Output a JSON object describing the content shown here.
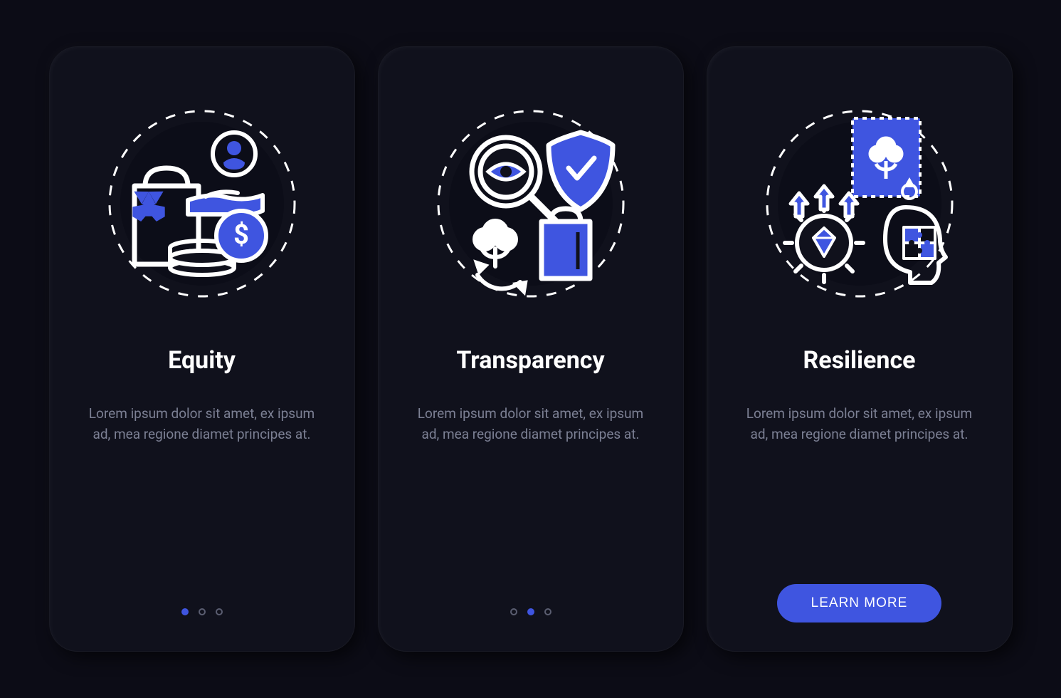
{
  "colors": {
    "accent": "#3f55e0",
    "stroke": "#ffffff",
    "bg": "#10111c",
    "text_muted": "#7c8094"
  },
  "cards": [
    {
      "title": "Equity",
      "description": "Lorem ipsum dolor sit amet, ex ipsum ad, mea regione diamet principes at.",
      "icon_name": "equity-icon",
      "pager_active": 0,
      "has_cta": false
    },
    {
      "title": "Transparency",
      "description": "Lorem ipsum dolor sit amet, ex ipsum ad, mea regione diamet principes at.",
      "icon_name": "transparency-icon",
      "pager_active": 1,
      "has_cta": false
    },
    {
      "title": "Resilience",
      "description": "Lorem ipsum dolor sit amet, ex ipsum ad, mea regione diamet principes at.",
      "icon_name": "resilience-icon",
      "pager_active": 2,
      "has_cta": true,
      "cta_label": "LEARN MORE"
    }
  ],
  "pager_total": 3
}
